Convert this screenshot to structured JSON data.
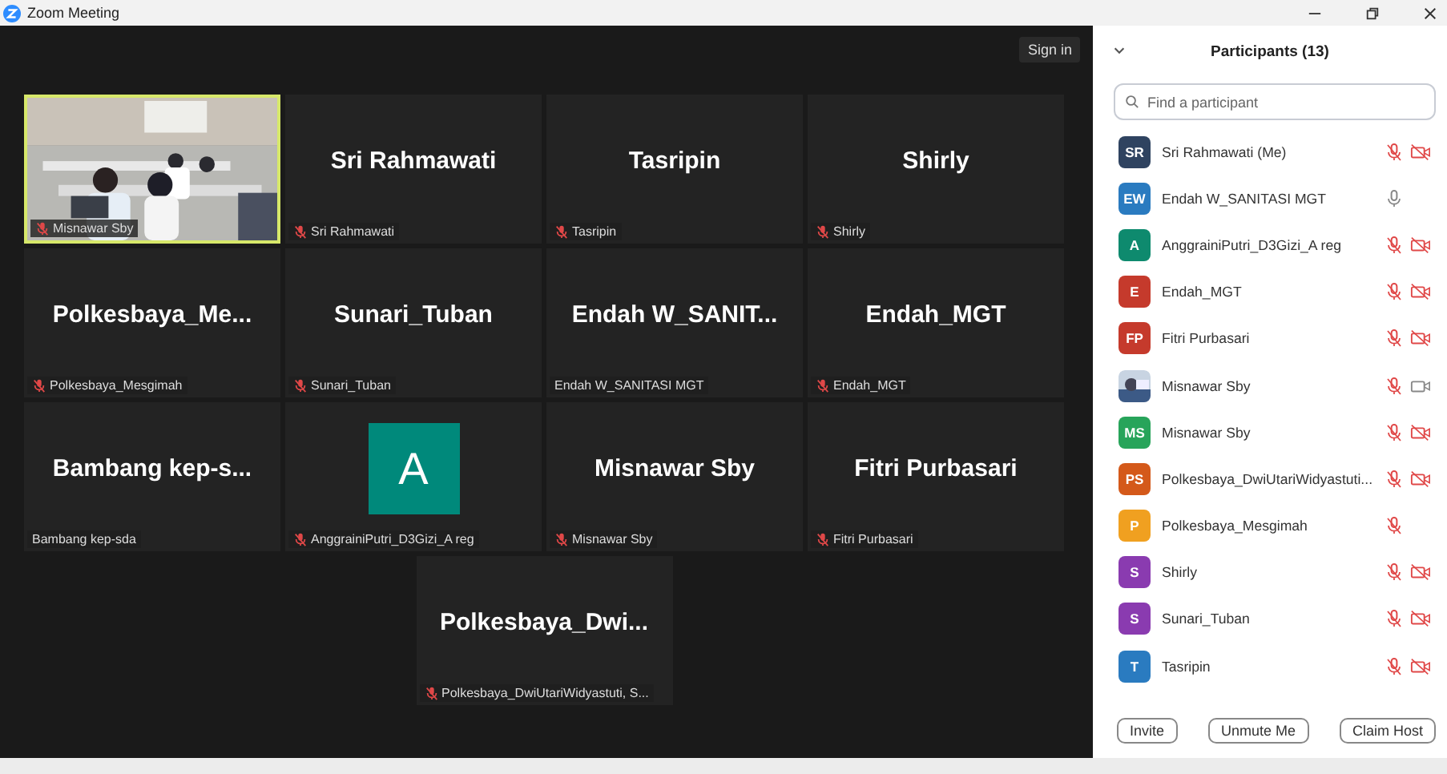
{
  "window": {
    "title": "Zoom Meeting"
  },
  "sign_in": "Sign in",
  "tiles": [
    {
      "kind": "video",
      "label": "Misnawar Sby",
      "muted": true,
      "speaking": true
    },
    {
      "kind": "name",
      "name": "Sri Rahmawati",
      "label": "Sri Rahmawati",
      "muted": true,
      "speaking": false
    },
    {
      "kind": "name",
      "name": "Tasripin",
      "label": "Tasripin",
      "muted": true,
      "speaking": false
    },
    {
      "kind": "name",
      "name": "Shirly",
      "label": "Shirly",
      "muted": true,
      "speaking": false
    },
    {
      "kind": "name",
      "name": "Polkesbaya_Me...",
      "label": "Polkesbaya_Mesgimah",
      "muted": true,
      "speaking": false
    },
    {
      "kind": "name",
      "name": "Sunari_Tuban",
      "label": "Sunari_Tuban",
      "muted": true,
      "speaking": false
    },
    {
      "kind": "name",
      "name": "Endah  W_SANIT...",
      "label": "Endah W_SANITASI MGT",
      "muted": false,
      "speaking": false
    },
    {
      "kind": "name",
      "name": "Endah_MGT",
      "label": "Endah_MGT",
      "muted": true,
      "speaking": false
    },
    {
      "kind": "name",
      "name": "Bambang  kep-s...",
      "label": "Bambang kep-sda",
      "muted": false,
      "speaking": false
    },
    {
      "kind": "avatar",
      "initial": "A",
      "color": "#00897b",
      "label": "AnggrainiPutri_D3Gizi_A reg",
      "muted": true,
      "speaking": false
    },
    {
      "kind": "name",
      "name": "Misnawar Sby",
      "label": "Misnawar Sby",
      "muted": true,
      "speaking": false
    },
    {
      "kind": "name",
      "name": "Fitri Purbasari",
      "label": "Fitri Purbasari",
      "muted": true,
      "speaking": false
    },
    {
      "kind": "name",
      "name": "Polkesbaya_Dwi...",
      "label": "Polkesbaya_DwiUtariWidyastuti, S...",
      "muted": true,
      "speaking": false
    }
  ],
  "participants_panel": {
    "title": "Participants (13)",
    "search": {
      "placeholder": "Find a participant"
    },
    "participants": [
      {
        "kind": "initials",
        "initials": "SR",
        "color": "#2f4360",
        "name": "Sri Rahmawati (Me)",
        "muted": true,
        "video_off": true
      },
      {
        "kind": "initials",
        "initials": "EW",
        "color": "#2a7bc0",
        "name": "Endah W_SANITASI MGT",
        "muted": false
      },
      {
        "kind": "initials",
        "initials": "A",
        "color": "#0e8a6e",
        "name": "AnggrainiPutri_D3Gizi_A reg",
        "muted": true,
        "video_off": true
      },
      {
        "kind": "initials",
        "initials": "E",
        "color": "#c53a2c",
        "name": "Endah_MGT",
        "muted": true,
        "video_off": true
      },
      {
        "kind": "initials",
        "initials": "FP",
        "color": "#c53a2c",
        "name": "Fitri Purbasari",
        "muted": true,
        "video_off": true
      },
      {
        "name": "Misnawar Sby",
        "muted": true,
        "video_off": false
      },
      {
        "kind": "initials",
        "initials": "MS",
        "color": "#27a45a",
        "name": "Misnawar Sby",
        "muted": true,
        "video_off": true
      },
      {
        "kind": "initials",
        "initials": "PS",
        "color": "#d4591a",
        "name": "Polkesbaya_DwiUtariWidyastuti...",
        "muted": true,
        "video_off": true
      },
      {
        "kind": "initials",
        "initials": "P",
        "color": "#f0a020",
        "name": "Polkesbaya_Mesgimah",
        "muted": true
      },
      {
        "kind": "initials",
        "initials": "S",
        "color": "#8a3bb0",
        "name": "Shirly",
        "muted": true,
        "video_off": true
      },
      {
        "kind": "initials",
        "initials": "S",
        "color": "#8a3bb0",
        "name": "Sunari_Tuban",
        "muted": true,
        "video_off": true
      },
      {
        "kind": "initials",
        "initials": "T",
        "color": "#2a7bc0",
        "name": "Tasripin",
        "muted": true,
        "video_off": true
      }
    ],
    "buttons": [
      "Invite",
      "Unmute Me",
      "Claim Host"
    ]
  }
}
